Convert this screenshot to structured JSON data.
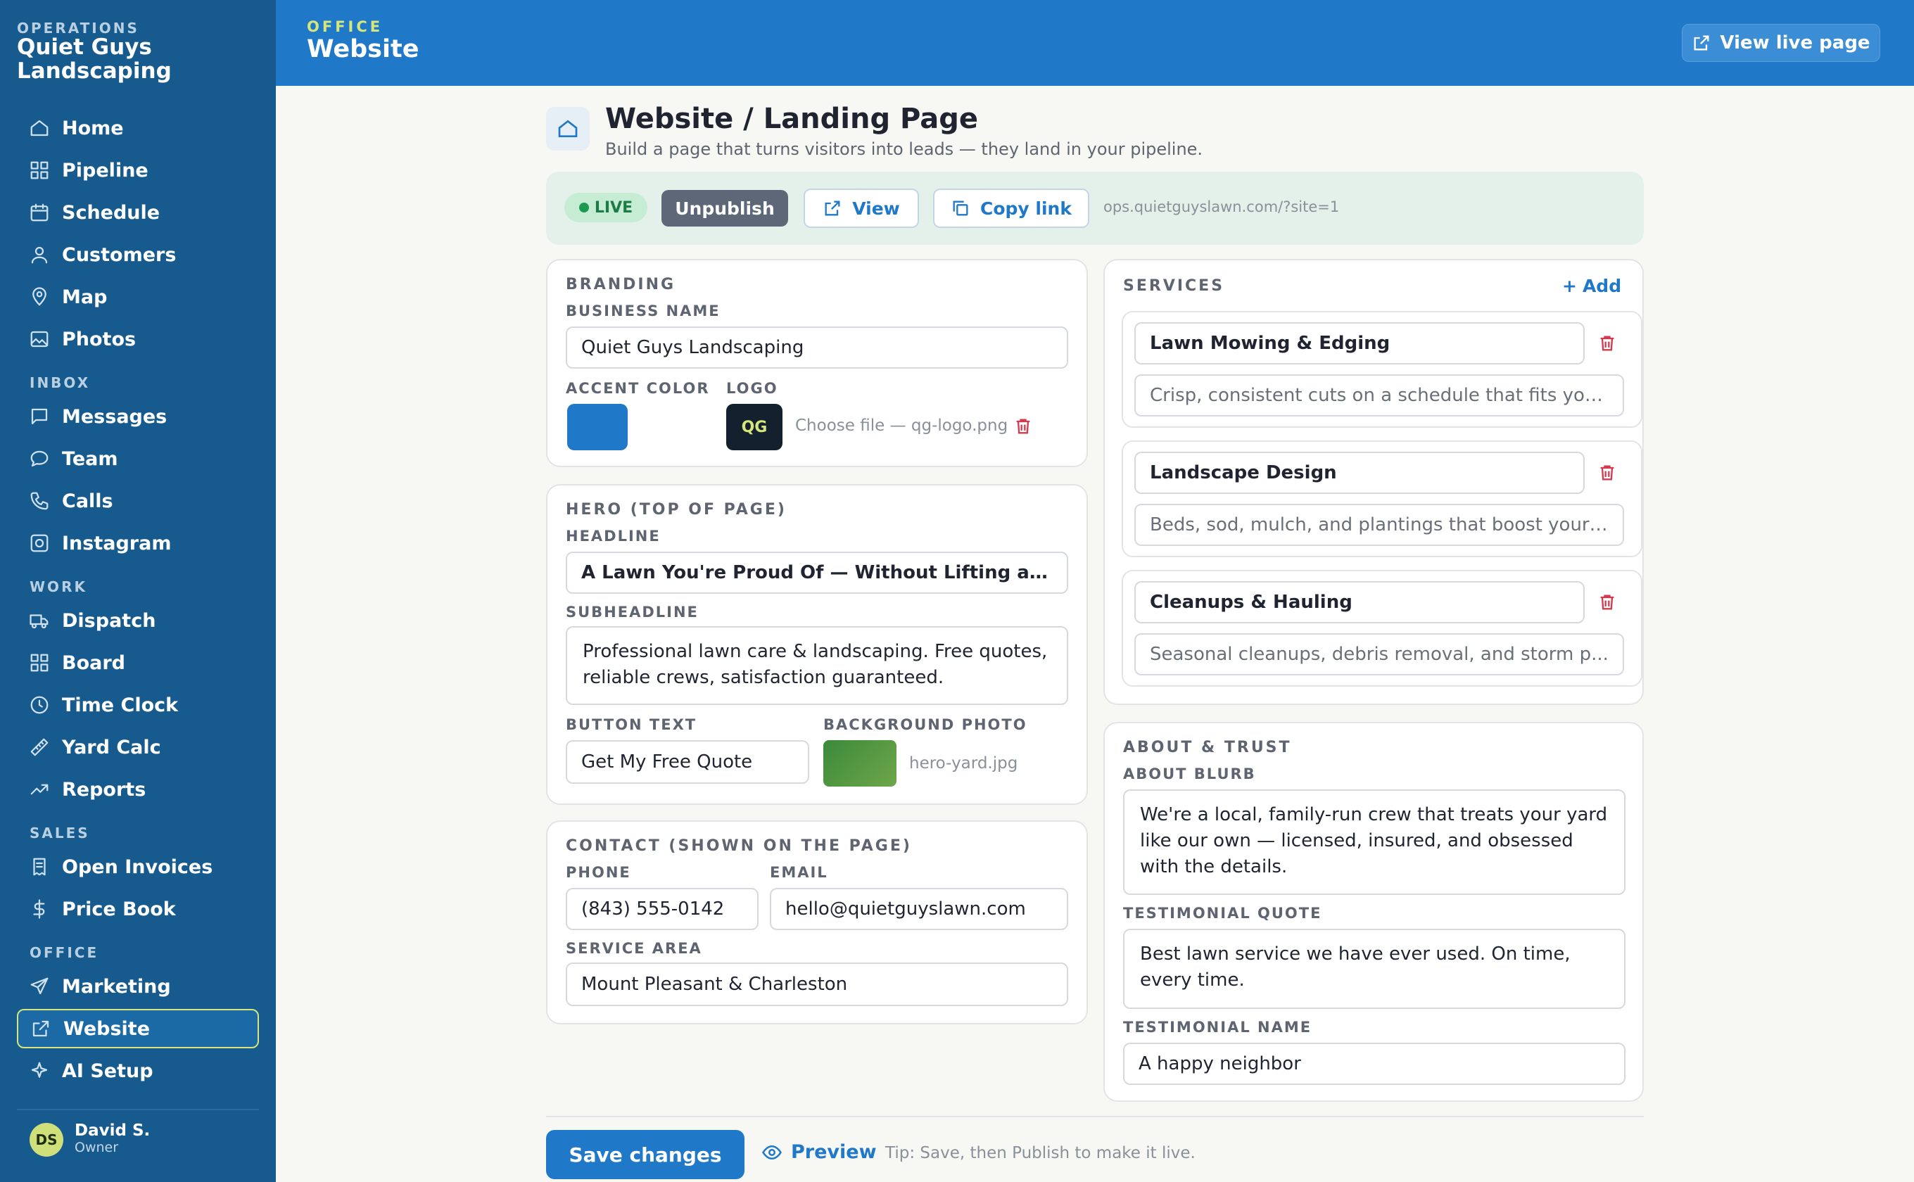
{
  "sidebar": {
    "kicker": "OPERATIONS",
    "brand": "Quiet Guys Landscaping",
    "items": [
      {
        "label": "Home",
        "icon": "home-icon"
      },
      {
        "label": "Pipeline",
        "icon": "grid-icon"
      },
      {
        "label": "Schedule",
        "icon": "calendar-icon"
      },
      {
        "label": "Customers",
        "icon": "user-icon"
      },
      {
        "label": "Map",
        "icon": "map-pin-icon"
      },
      {
        "label": "Photos",
        "icon": "image-icon"
      }
    ],
    "inbox_label": "INBOX",
    "inbox": [
      {
        "label": "Messages",
        "icon": "message-icon"
      },
      {
        "label": "Team",
        "icon": "chat-bubble-icon"
      },
      {
        "label": "Calls",
        "icon": "phone-icon"
      },
      {
        "label": "Instagram",
        "icon": "instagram-icon"
      }
    ],
    "work_label": "WORK",
    "work": [
      {
        "label": "Dispatch",
        "icon": "truck-icon"
      },
      {
        "label": "Board",
        "icon": "grid-icon"
      },
      {
        "label": "Time Clock",
        "icon": "clock-icon"
      },
      {
        "label": "Yard Calc",
        "icon": "ruler-icon"
      },
      {
        "label": "Reports",
        "icon": "trend-icon"
      }
    ],
    "sales_label": "SALES",
    "sales": [
      {
        "label": "Open Invoices",
        "icon": "receipt-icon"
      },
      {
        "label": "Price Book",
        "icon": "dollar-icon"
      }
    ],
    "office_label": "OFFICE",
    "office": [
      {
        "label": "Marketing",
        "icon": "send-icon"
      },
      {
        "label": "Website",
        "icon": "external-link-icon",
        "active": true
      },
      {
        "label": "AI Setup",
        "icon": "sparkle-icon"
      }
    ],
    "user": {
      "initials": "DS",
      "name": "David S.",
      "role": "Owner"
    }
  },
  "topbar": {
    "kicker": "OFFICE",
    "title": "Website",
    "live_button": "View live page"
  },
  "page": {
    "title": "Website / Landing Page",
    "subtitle": "Build a page that turns visitors into leads — they land in your pipeline."
  },
  "publish": {
    "status": "LIVE",
    "unpublish": "Unpublish",
    "view": "View",
    "copy_link": "Copy link",
    "url": "ops.quietguyslawn.com/?site=1"
  },
  "branding": {
    "title": "BRANDING",
    "business_name_label": "BUSINESS NAME",
    "business_name": "Quiet Guys Landscaping",
    "accent_label": "ACCENT COLOR",
    "accent_color": "#1f78c8",
    "logo_label": "LOGO",
    "logo_text": "QG",
    "logo_file": "Choose file — qg-logo.png"
  },
  "hero": {
    "title": "HERO (TOP OF PAGE)",
    "headline_label": "HEADLINE",
    "headline": "A Lawn You're Proud Of — Without Lifting a F...",
    "subheadline_label": "SUBHEADLINE",
    "subheadline": "Professional lawn care & landscaping. Free quotes, reliable crews, satisfaction guaranteed.",
    "button_label": "BUTTON TEXT",
    "button_text": "Get My Free Quote",
    "bg_label": "BACKGROUND PHOTO",
    "bg_file": "hero-yard.jpg"
  },
  "contact": {
    "title": "CONTACT (SHOWN ON THE PAGE)",
    "phone_label": "PHONE",
    "phone": "(843) 555-0142",
    "email_label": "EMAIL",
    "email": "hello@quietguyslawn.com",
    "area_label": "SERVICE AREA",
    "area": "Mount Pleasant & Charleston"
  },
  "services": {
    "title": "SERVICES",
    "add": "Add",
    "items": [
      {
        "name": "Lawn Mowing & Edging",
        "desc": "Crisp, consistent cuts on a schedule that fits you..."
      },
      {
        "name": "Landscape Design",
        "desc": "Beds, sod, mulch, and plantings that boost your ..."
      },
      {
        "name": "Cleanups & Hauling",
        "desc": "Seasonal cleanups, debris removal, and storm p..."
      }
    ]
  },
  "about": {
    "title": "ABOUT & TRUST",
    "blurb_label": "ABOUT BLURB",
    "blurb": "We're a local, family-run crew that treats your yard like our own — licensed, insured, and obsessed with the details.",
    "quote_label": "TESTIMONIAL QUOTE",
    "quote": "Best lawn service we have ever used. On time, every time.",
    "name_label": "TESTIMONIAL NAME",
    "name": "A happy neighbor"
  },
  "footer": {
    "save": "Save changes",
    "preview": "Preview",
    "tip": "Tip: Save, then Publish to make it live."
  }
}
